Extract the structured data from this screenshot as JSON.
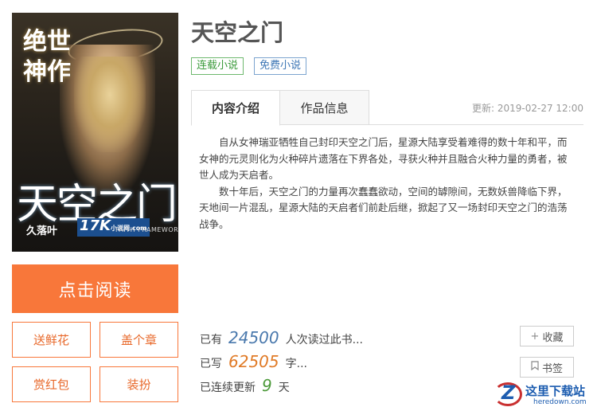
{
  "cover": {
    "tagline": "绝世神作",
    "title": "天空之门",
    "author": "久落叶",
    "publisher": "17K",
    "publisher_sub": "小说网.com",
    "series": "FAITH FRAMEWORK"
  },
  "actions": {
    "read": "点击阅读",
    "flower": "送鲜花",
    "stamp": "盖个章",
    "reward": "赏红包",
    "dress": "装扮"
  },
  "book": {
    "title": "天空之门",
    "tags": [
      "连载小说",
      "免费小说"
    ]
  },
  "tabs": {
    "intro": "内容介绍",
    "info": "作品信息",
    "updated": "更新: 2019-02-27 12:00"
  },
  "intro": {
    "p1": "自从女神瑞亚牺牲自己封印天空之门后，星源大陆享受着难得的数十年和平，而女神的元灵则化为火种碎片遗落在下界各处，寻获火种并且融合火种力量的勇者，被世人成为天启者。",
    "p2": "数十年后，天空之门的力量再次蠢蠢欲动，空间的罅隙间，无数妖兽降临下界，天地间一片混乱，星源大陆的天启者们前赴后继，掀起了又一场封印天空之门的浩荡战争。"
  },
  "stats": {
    "readers_prefix": "已有",
    "readers": "24500",
    "readers_suffix": "人次读过此书...",
    "words_prefix": "已写",
    "words": "62505",
    "words_suffix": "字...",
    "days_prefix": "已连续更新",
    "days": "9",
    "days_suffix": "天"
  },
  "side": {
    "favorite_icon": "+",
    "favorite": "收藏",
    "bookmark": "书签"
  },
  "watermark": {
    "cn": "这里下载站",
    "en": "heredown.com"
  }
}
